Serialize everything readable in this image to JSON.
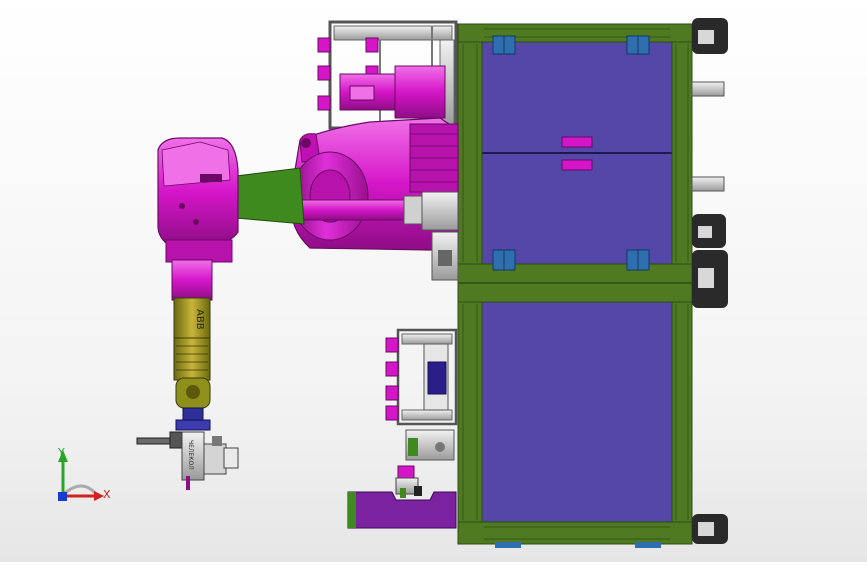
{
  "view": {
    "triad": {
      "x_label": "X",
      "y_label": "Y"
    },
    "brand_label": "ABB",
    "gripper_label": "ЧЕЛЕКОЛ"
  },
  "colors": {
    "robot": "#d516c8",
    "robot_dark": "#8e0d86",
    "robot_light": "#f060e8",
    "link_green": "#3f8a1e",
    "wrist_olive": "#8f8f1c",
    "wrist_gold": "#b9a22a",
    "frame_green": "#4f7a22",
    "frame_dark": "#2c4c12",
    "panel_blue": "#5447a8",
    "hinge_blue": "#2f6fb0",
    "fixture_purple": "#7a22a0",
    "steel": "#c8c8c8",
    "dark": "#202020"
  }
}
